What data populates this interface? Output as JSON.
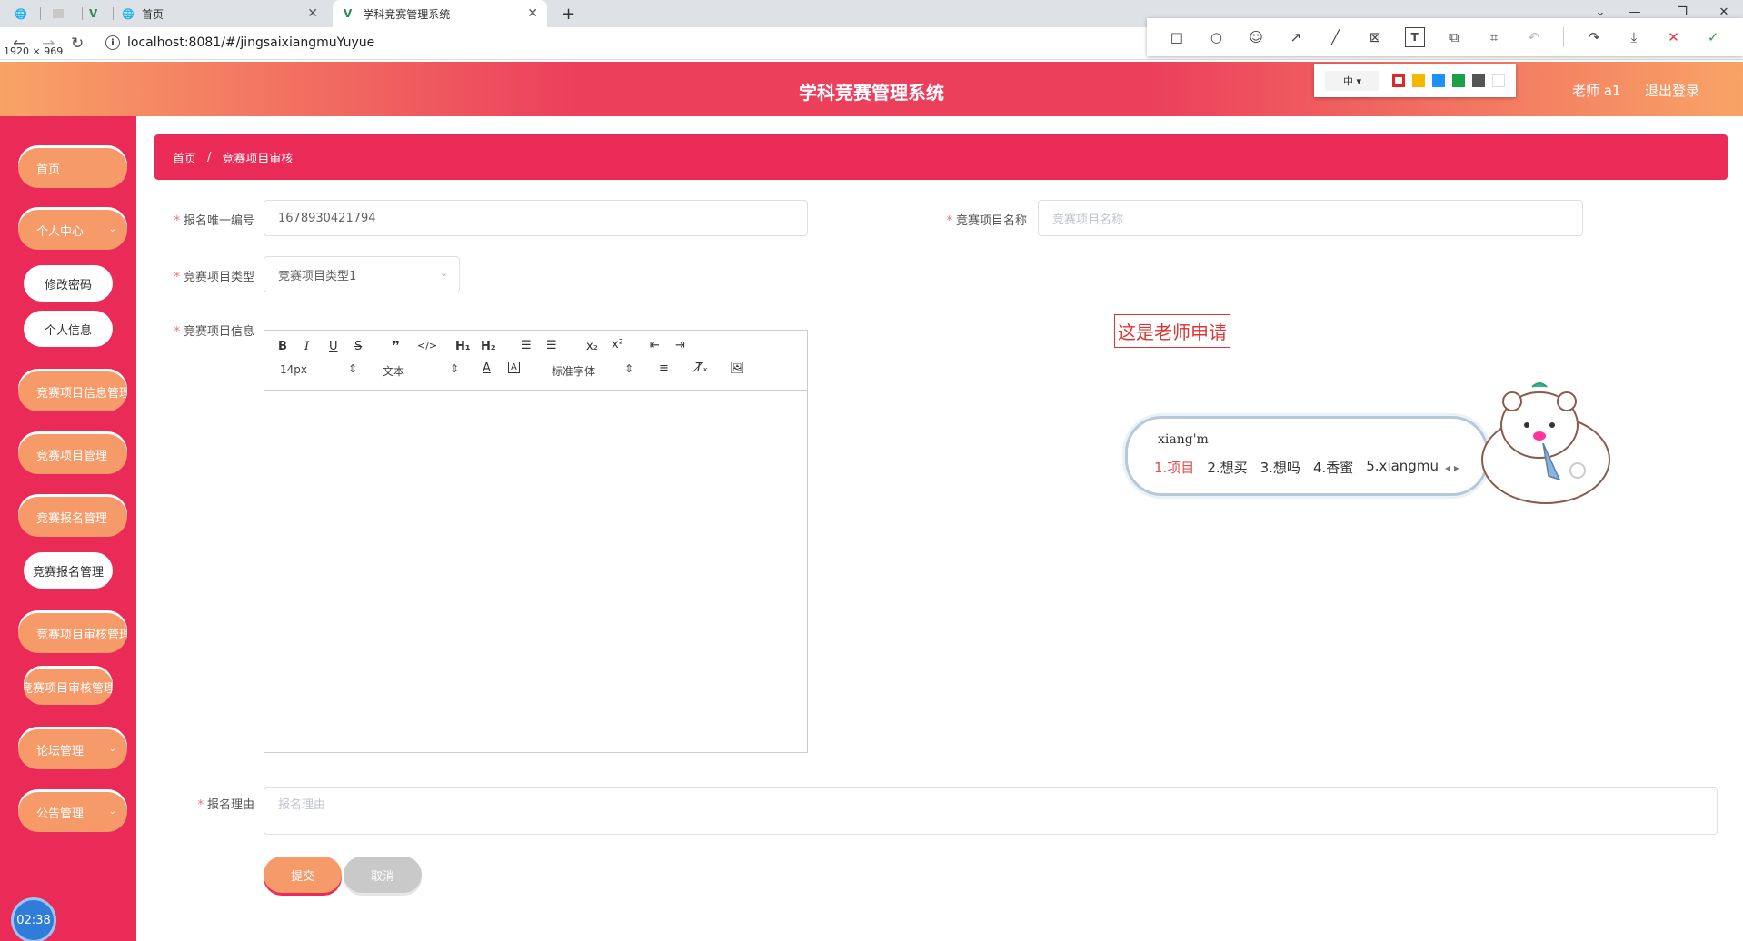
{
  "browser": {
    "tabs": [
      {
        "title": "",
        "icon": "globe-icon"
      },
      {
        "title": "",
        "icon": "blank-page-icon"
      },
      {
        "title": "",
        "icon": "vue-icon"
      },
      {
        "title": "首页",
        "icon": "globe-icon"
      },
      {
        "title": "学科竞赛管理系统",
        "icon": "vue-icon"
      }
    ],
    "new_tab": "+",
    "url": "localhost:8081/#/jingsaixiangmuYuyue",
    "dimensions": "1920 × 969"
  },
  "screenshot_tool": {
    "size_label": "中 ▾",
    "colors": [
      "#e02828",
      "#f5b800",
      "#1e90ff",
      "#1aa14a",
      "#555555",
      "#ffffff"
    ]
  },
  "header": {
    "title": "学科竞赛管理系统",
    "user": "老师 a1",
    "logout": "退出登录"
  },
  "sidebar": {
    "home": "首页",
    "personal_center": "个人中心",
    "change_password": "修改密码",
    "personal_info": "个人信息",
    "project_info_mgmt": "竞赛项目信息管理",
    "project_mgmt": "竞赛项目管理",
    "signup_mgmt": "竞赛报名管理",
    "signup_mgmt_sub": "竞赛报名管理",
    "review_mgmt": "竞赛项目审核管理",
    "review_mgmt_sub": "竞赛项目审核管理",
    "forum_mgmt": "论坛管理",
    "notice_mgmt": "公告管理",
    "clock": "02:38"
  },
  "breadcrumb": {
    "home": "首页",
    "separator": "/",
    "current": "竞赛项目审核"
  },
  "form": {
    "signup_id_label": "报名唯一编号",
    "signup_id_value": "1678930421794",
    "project_name_label": "竞赛项目名称",
    "project_name_placeholder": "竞赛项目名称",
    "project_type_label": "竞赛项目类型",
    "project_type_value": "竞赛项目类型1",
    "project_info_label": "竞赛项目信息",
    "reason_label": "报名理由",
    "reason_placeholder": "报名理由",
    "submit": "提交",
    "cancel": "取消"
  },
  "editor": {
    "font_size": "14px",
    "block_type": "文本",
    "font_family": "标准字体"
  },
  "annotation": {
    "text": "这是老师申请"
  },
  "ime": {
    "pinyin": "xiang'm",
    "candidates": [
      "1.项目",
      "2.想买",
      "3.想吗",
      "4.香蜜",
      "5.xiangmu"
    ]
  }
}
